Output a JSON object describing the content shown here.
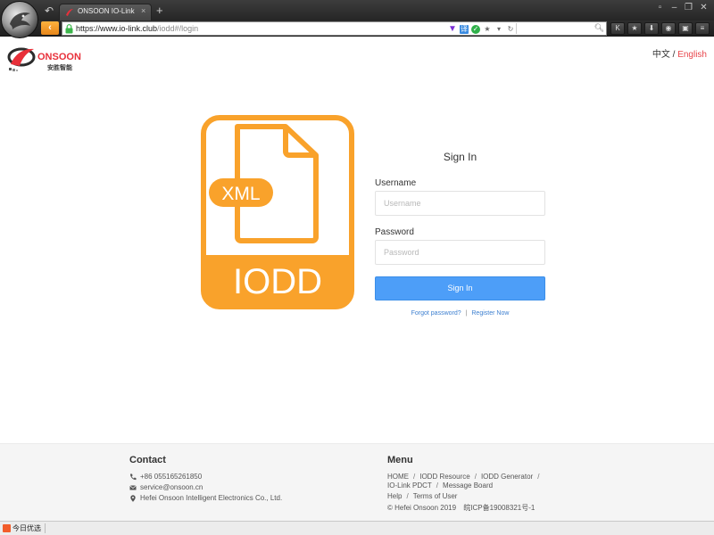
{
  "browser": {
    "tab_title": "ONSOON IO-Link",
    "url_host": "https://www.io-link.club",
    "url_path": "/iodd#/login",
    "new_tab_label": "+",
    "close_tab_label": "×"
  },
  "header": {
    "logo_text": "ONSOON",
    "logo_subtext": "安胜智能",
    "lang_cn": "中文",
    "lang_separator": "/",
    "lang_en": "English"
  },
  "graphic": {
    "badge_text": "XML",
    "label_text": "IODD",
    "accent_color": "#f9a22b"
  },
  "login": {
    "title": "Sign In",
    "username_label": "Username",
    "username_placeholder": "Username",
    "password_label": "Password",
    "password_placeholder": "Password",
    "submit_label": "Sign In",
    "forgot_link": "Forgot password?",
    "link_separator": "|",
    "register_link": "Register Now",
    "button_color": "#4d9ef8"
  },
  "footer": {
    "contact_heading": "Contact",
    "phone": "+86 055165261850",
    "email": "service@onsoon.cn",
    "address": "Hefei Onsoon Intelligent Electronics Co., Ltd.",
    "menu_heading": "Menu",
    "menu_items": [
      "HOME",
      "IODD Resource",
      "IODD Generator",
      "IO-Link PDCT",
      "Message Board",
      "Help",
      "Terms of User"
    ],
    "menu_separator": "/",
    "copyright": "© Hefei Onsoon 2019",
    "icp": "皖ICP备19008321号-1"
  },
  "status_bar": {
    "item_label": "今日优选"
  }
}
